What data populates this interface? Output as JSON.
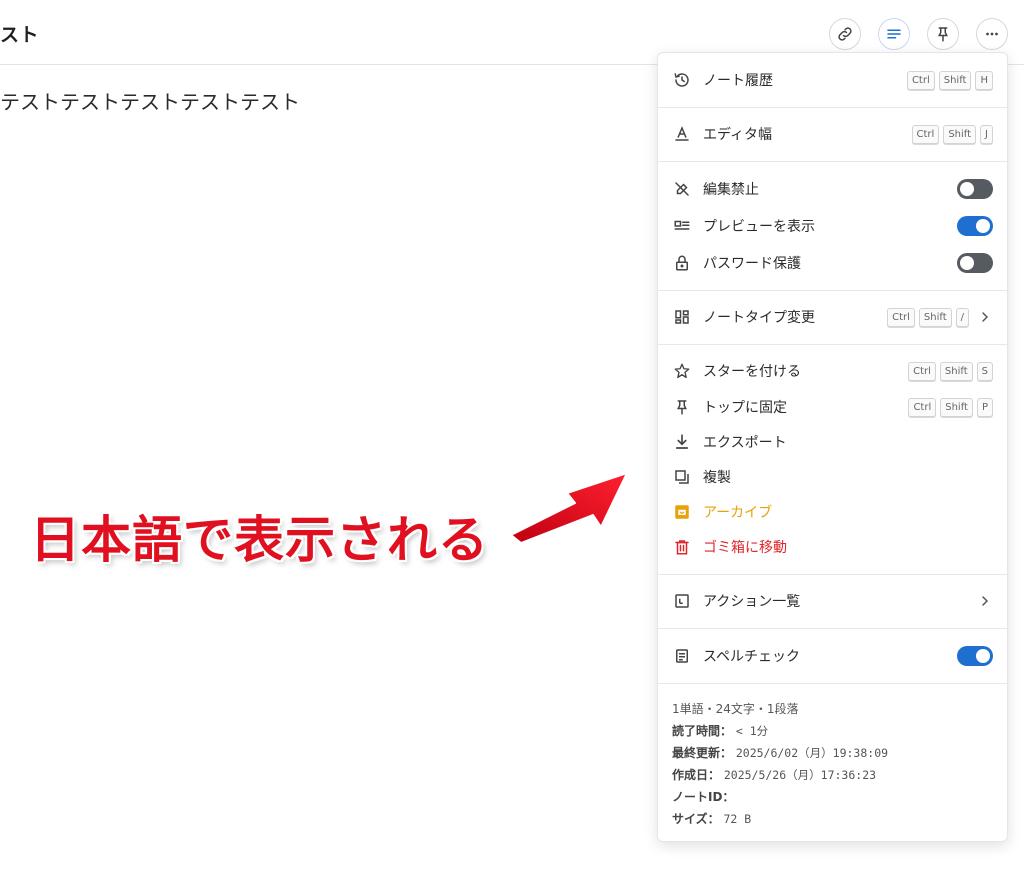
{
  "note": {
    "title": "スト",
    "body": "テストテストテストテストテスト"
  },
  "toolbar": {
    "buttons": [
      "link-icon",
      "lines-icon",
      "pin-icon",
      "more-icon"
    ],
    "accent": "#1f6fd1"
  },
  "menu": {
    "history": {
      "label": "ノート履歴",
      "keys": [
        "Ctrl",
        "Shift",
        "H"
      ]
    },
    "editor_width": {
      "label": "エディタ幅",
      "keys": [
        "Ctrl",
        "Shift",
        "J"
      ]
    },
    "no_edit": {
      "label": "編集禁止",
      "enabled": false
    },
    "show_preview": {
      "label": "プレビューを表示",
      "enabled": true
    },
    "password": {
      "label": "パスワード保護",
      "enabled": false
    },
    "note_type": {
      "label": "ノートタイプ変更",
      "keys": [
        "Ctrl",
        "Shift",
        "/"
      ]
    },
    "star": {
      "label": "スターを付ける",
      "keys": [
        "Ctrl",
        "Shift",
        "S"
      ]
    },
    "pin_top": {
      "label": "トップに固定",
      "keys": [
        "Ctrl",
        "Shift",
        "P"
      ]
    },
    "export": {
      "label": "エクスポート"
    },
    "duplicate": {
      "label": "複製"
    },
    "archive": {
      "label": "アーカイブ",
      "color": "#e8a10a"
    },
    "trash": {
      "label": "ゴミ箱に移動",
      "color": "#e0262b"
    },
    "actions": {
      "label": "アクション一覧"
    },
    "spellcheck": {
      "label": "スペルチェック",
      "enabled": true
    }
  },
  "info": {
    "stats": "1単語・24文字・1段落",
    "read_time_label": "読了時間：",
    "read_time_value": "< 1分",
    "updated_label": "最終更新：",
    "updated_value": "2025/6/02（月）19:38:09",
    "created_label": "作成日：",
    "created_value": "2025/5/26（月）17:36:23",
    "id_label": "ノートID：",
    "size_label": "サイズ：",
    "size_value": "72 B"
  },
  "annotation": {
    "text": "日本語で表示される",
    "color": "#e01020"
  }
}
